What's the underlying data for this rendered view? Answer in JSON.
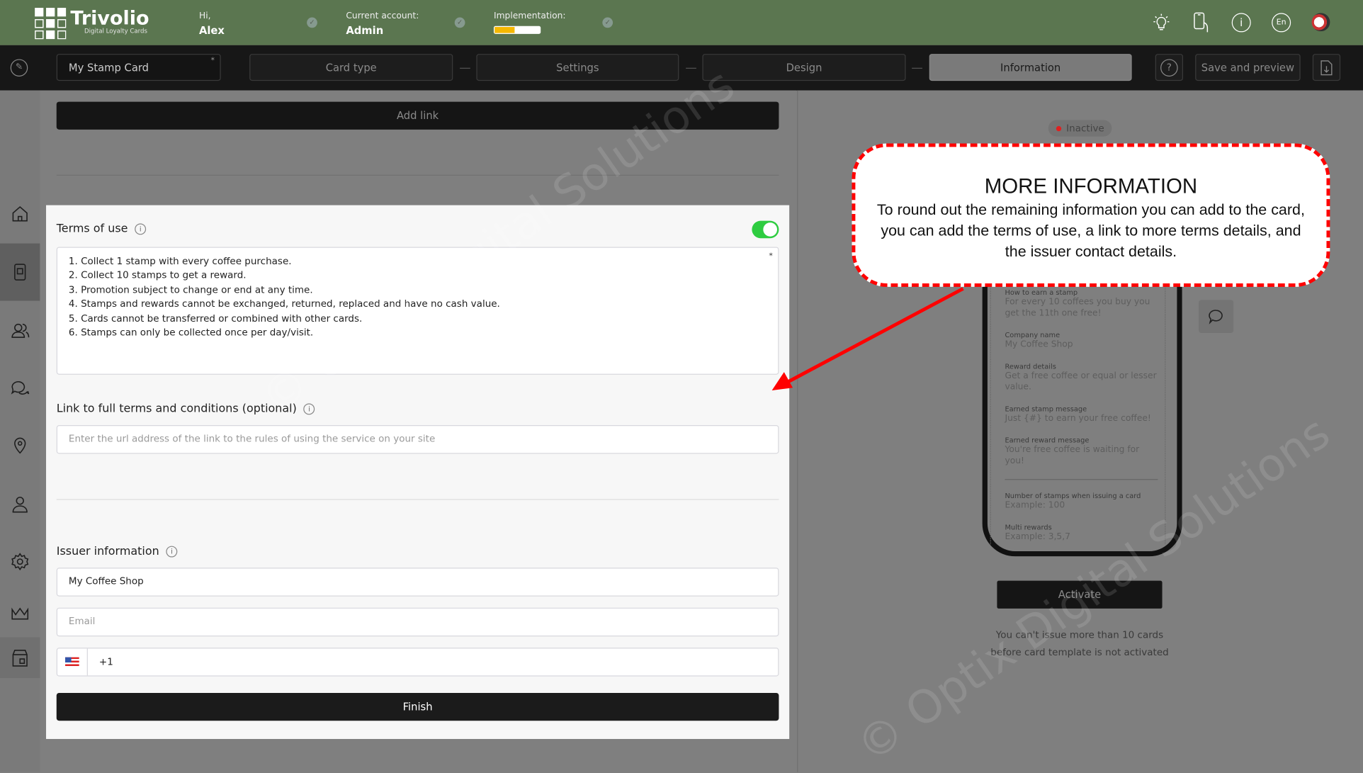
{
  "header": {
    "logo": {
      "name": "Trivolio",
      "tagline": "Digital Loyalty Cards"
    },
    "greeting": "Hi,",
    "user": "Alex",
    "account_label": "Current account:",
    "account": "Admin",
    "implementation_label": "Implementation:",
    "implementation_progress": 0.45,
    "progress_color": "#f5b800",
    "icons": [
      "lightbulb-icon",
      "phone-touch-icon",
      "info-icon",
      "language-icon",
      "avatar"
    ],
    "language": "En"
  },
  "steps": {
    "card_name": "My Stamp Card",
    "required_mark": "*",
    "items": [
      "Card type",
      "Settings",
      "Design",
      "Information"
    ],
    "active": "Information",
    "save_preview": "Save and preview"
  },
  "sidebar": {
    "icons": [
      "home-icon",
      "phone-card-icon",
      "users-icon",
      "chat-icon",
      "location-icon",
      "user-icon",
      "gear-icon",
      "crown-icon",
      "store-icon"
    ],
    "active": "phone-card-icon"
  },
  "form": {
    "add_link": "Add link",
    "terms": {
      "label": "Terms of use",
      "enabled": true,
      "required_mark": "*",
      "lines": [
        "1. Collect 1 stamp with every coffee purchase.",
        "2. Collect 10 stamps to get a reward.",
        "3. Promotion subject to change or end at any time.",
        "4. Stamps and rewards cannot be exchanged, returned, replaced and have no cash value.",
        "5. Cards cannot be transferred or combined with other cards.",
        "6. Stamps can only be collected once per day/visit."
      ]
    },
    "link": {
      "label": "Link to full terms and conditions (optional)",
      "placeholder": "Enter the url address of the link to the rules of using the service on your site",
      "value": ""
    },
    "issuer": {
      "label": "Issuer information",
      "company": "My Coffee Shop",
      "email_placeholder": "Email",
      "phone_country": "US",
      "phone_prefix": "+1"
    },
    "finish": "Finish"
  },
  "preview": {
    "status": "Inactive",
    "status_color": "#e02020",
    "fields": [
      {
        "label": "How to earn a stamp",
        "value": "For every 10 coffees you buy you get the 11th one free!"
      },
      {
        "label": "Company name",
        "value": "My Coffee Shop"
      },
      {
        "label": "Reward details",
        "value": "Get a free coffee or equal or lesser value."
      },
      {
        "label": "Earned stamp message",
        "value": "Just {#} to earn your free coffee!"
      },
      {
        "label": "Earned reward message",
        "value": "You're free coffee is waiting for you!"
      },
      {
        "label": "Number of stamps when issuing a card",
        "value": "Example: 100"
      },
      {
        "label": "Multi rewards",
        "value": "Example: 3,5,7"
      }
    ],
    "activate": "Activate",
    "note": "You can't issue more than 10 cards before card template is not activated"
  },
  "callout": {
    "title": "MORE INFORMATION",
    "body": "To round out the remaining information you can add to the card, you can add the terms of use, a link to more terms details, and the issuer contact details.",
    "border_color": "#ff0000"
  },
  "watermark": "© Optix Digital Solutions"
}
